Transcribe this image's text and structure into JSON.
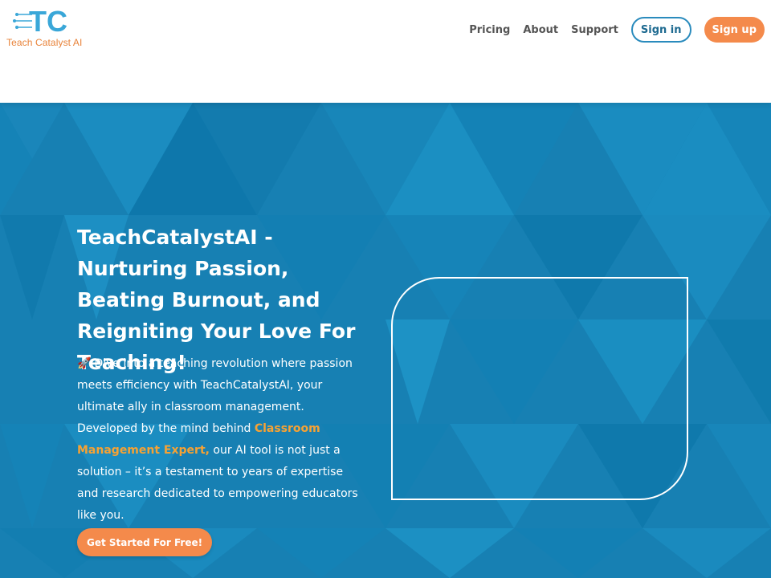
{
  "brand": {
    "logo_letters": "TC",
    "name": "Teach Catalyst AI",
    "primary_color": "#1780b3",
    "accent_color": "#f48a4b",
    "highlight_color": "#f7a233"
  },
  "nav": {
    "links": [
      "Pricing",
      "About",
      "Support"
    ],
    "sign_in": "Sign in",
    "sign_up": "Sign up"
  },
  "hero": {
    "headline": "TeachCatalystAI - Nurturing Passion, Beating Burnout, and Reigniting Your Love For Teaching!",
    "rocket_icon": "🚀",
    "desc_part1": "Dive into a teaching revolution where passion meets efficiency with TeachCatalystAI, your ultimate ally in classroom management. Developed by the mind behind ",
    "desc_link": "Classroom Management Expert,",
    "desc_part2": " our AI tool is not just a solution – it’s a testament to years of expertise and research dedicated to empowering educators like you.",
    "cta": "Get Started For Free!"
  }
}
